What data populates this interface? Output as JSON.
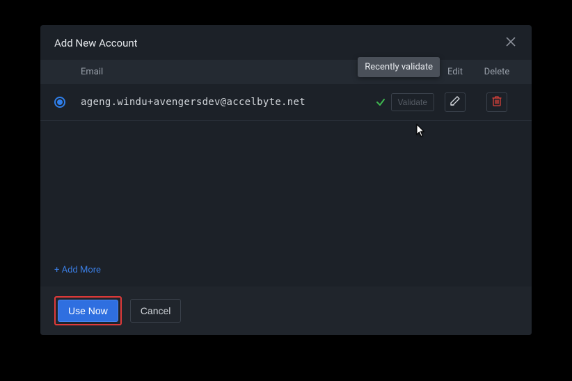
{
  "dialog": {
    "title": "Add New Account"
  },
  "columns": {
    "email": "Email",
    "edit": "Edit",
    "delete": "Delete"
  },
  "tooltip": "Recently validate",
  "row": {
    "email": "ageng.windu+avengersdev@accelbyte.net",
    "validate_label": "Validate"
  },
  "add_more": "+ Add More",
  "buttons": {
    "primary": "Use Now",
    "secondary": "Cancel"
  }
}
